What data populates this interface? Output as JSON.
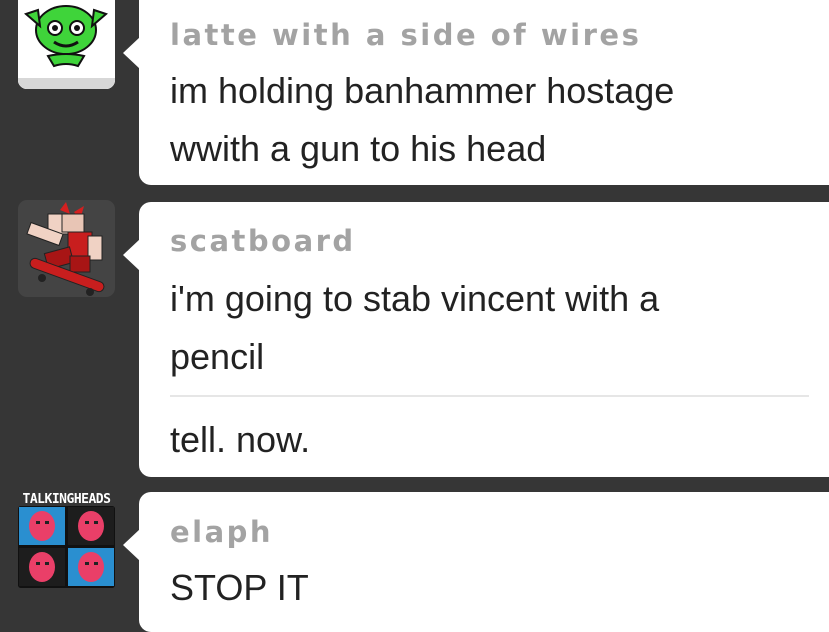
{
  "messages": [
    {
      "username": "latte with a side of wires",
      "avatar": "green-creature-avatar-icon",
      "lines": [
        "im holding banhammer hostage",
        "wwith a gun to his head"
      ]
    },
    {
      "username": "scatboard",
      "avatar": "skateboarder-avatar-icon",
      "lines": [
        "i'm going to stab vincent with a",
        "pencil"
      ],
      "followup": "tell. now."
    },
    {
      "username": "elaph",
      "avatar": "talking-heads-album-avatar-icon",
      "album_title": "TALKINGHEADS",
      "lines": [
        "STOP IT"
      ]
    }
  ],
  "colors": {
    "background": "#363636",
    "bubble": "#ffffff",
    "username": "#a3a3a3",
    "text": "#222222"
  }
}
